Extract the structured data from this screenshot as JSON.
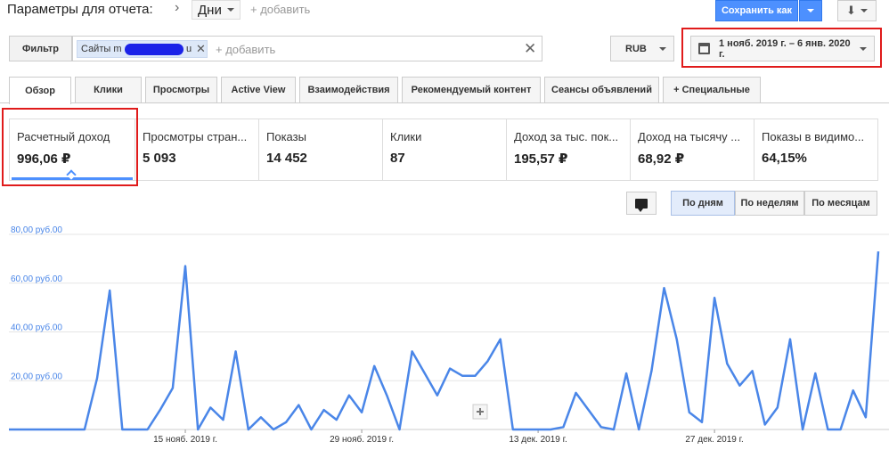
{
  "header": {
    "title": "Параметры для отчета:",
    "dimension": "Дни",
    "add": "+ добавить",
    "save": "Сохранить как"
  },
  "filter": {
    "label": "Фильтр",
    "chip_prefix": "Сайты m",
    "chip_suffix": "u",
    "add": "+ добавить"
  },
  "currency": "RUB",
  "date_range": "1 нояб. 2019 г. – 6 янв. 2020 г.",
  "tabs": [
    "Обзор",
    "Клики",
    "Просмотры",
    "Active View",
    "Взаимодействия",
    "Рекомендуемый контент",
    "Сеансы объявлений",
    "+  Специальные"
  ],
  "metrics": [
    {
      "label": "Расчетный доход",
      "value": "996,06 ₽"
    },
    {
      "label": "Просмотры стран...",
      "value": "5 093"
    },
    {
      "label": "Показы",
      "value": "14 452"
    },
    {
      "label": "Клики",
      "value": "87"
    },
    {
      "label": "Доход за тыс. пок...",
      "value": "195,57 ₽"
    },
    {
      "label": "Доход на тысячу ...",
      "value": "68,92 ₽"
    },
    {
      "label": "Показы в видимо...",
      "value": "64,15%"
    }
  ],
  "grouping": [
    "По дням",
    "По неделям",
    "По месяцам"
  ],
  "colors": {
    "accent": "#4d90fe",
    "highlight": "#e01b1b",
    "line": "#4a86e8"
  },
  "chart_data": {
    "type": "line",
    "y_ticks": [
      "80,00 руб.00",
      "60,00 руб.00",
      "40,00 руб.00",
      "20,00 руб.00"
    ],
    "y_tick_values": [
      80,
      60,
      40,
      20
    ],
    "ylim": [
      0,
      80
    ],
    "x_ticks": [
      "15 нояб. 2019 г.",
      "29 нояб. 2019 г.",
      "13 дек. 2019 г.",
      "27 дек. 2019 г."
    ],
    "x_tick_days": [
      14,
      28,
      42,
      56
    ],
    "grid": true,
    "series": [
      {
        "values": [
          0,
          0,
          0,
          0,
          0,
          0,
          0,
          21,
          57,
          0,
          0,
          0,
          8,
          17,
          67,
          0,
          9,
          4,
          32,
          0,
          5,
          0,
          3,
          10,
          0,
          8,
          4,
          14,
          7,
          26,
          14,
          0,
          32,
          23,
          14,
          25,
          22,
          22,
          28,
          37,
          0,
          0,
          0,
          0,
          1,
          15,
          8,
          1,
          0,
          23,
          0,
          24,
          58,
          37,
          7,
          3,
          54,
          27,
          18,
          24,
          2,
          9,
          37,
          0,
          23,
          0,
          0,
          16,
          5,
          73
        ]
      }
    ]
  }
}
